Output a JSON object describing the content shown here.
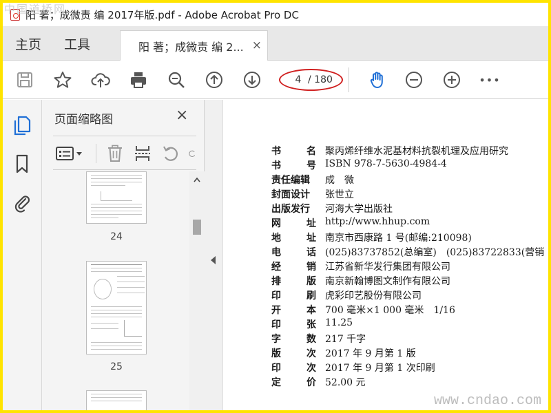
{
  "watermark": {
    "top_left": "中国道桥网",
    "bottom_right": "www.cndao.com"
  },
  "window": {
    "title": "阳 著；成微责 编 2017年版.pdf - Adobe Acrobat Pro DC"
  },
  "tabs": {
    "home": "主页",
    "tools": "工具",
    "document": "阳 著；成微责 编 2...",
    "close": "×"
  },
  "toolbar": {
    "current_page": "4",
    "total_pages": "/ 180",
    "more": "•••"
  },
  "panel": {
    "title": "页面缩略图",
    "close": "×",
    "thumbnails": [
      {
        "page": "24"
      },
      {
        "page": "25"
      }
    ]
  },
  "document": {
    "rows": [
      {
        "label": [
          "书",
          "名"
        ],
        "value": "聚丙烯纤维水泥基材料抗裂机理及应用研究"
      },
      {
        "label": [
          "书",
          "号"
        ],
        "value": "ISBN 978-7-5630-4984-4"
      },
      {
        "label": [
          "责任编辑"
        ],
        "value": "成　微"
      },
      {
        "label": [
          "封面设计"
        ],
        "value": "张世立"
      },
      {
        "label": [
          "出版发行"
        ],
        "value": "河海大学出版社"
      },
      {
        "label": [
          "网",
          "址"
        ],
        "value": "http://www.hhup.com"
      },
      {
        "label": [
          "地",
          "址"
        ],
        "value": "南京市西康路 1 号(邮编:210098)"
      },
      {
        "label": [
          "电",
          "话"
        ],
        "value": "(025)83737852(总编室)　(025)83722833(营销"
      },
      {
        "label": [
          "经",
          "销"
        ],
        "value": "江苏省新华发行集团有限公司"
      },
      {
        "label": [
          "排",
          "版"
        ],
        "value": "南京新翰博图文制作有限公司"
      },
      {
        "label": [
          "印",
          "刷"
        ],
        "value": "虎彩印艺股份有限公司"
      },
      {
        "label": [
          "开",
          "本"
        ],
        "value": "700 毫米×1 000 毫米　1/16"
      },
      {
        "label": [
          "印",
          "张"
        ],
        "value": "11.25"
      },
      {
        "label": [
          "字",
          "数"
        ],
        "value": "217 千字"
      },
      {
        "label": [
          "版",
          "次"
        ],
        "value": "2017 年 9 月第 1 版"
      },
      {
        "label": [
          "印",
          "次"
        ],
        "value": "2017 年 9 月第 1 次印刷"
      },
      {
        "label": [
          "定",
          "价"
        ],
        "value": "52.00 元"
      }
    ]
  },
  "colors": {
    "accent": "#1f6fd6",
    "annotation": "#d02020",
    "icon": "#555555"
  }
}
